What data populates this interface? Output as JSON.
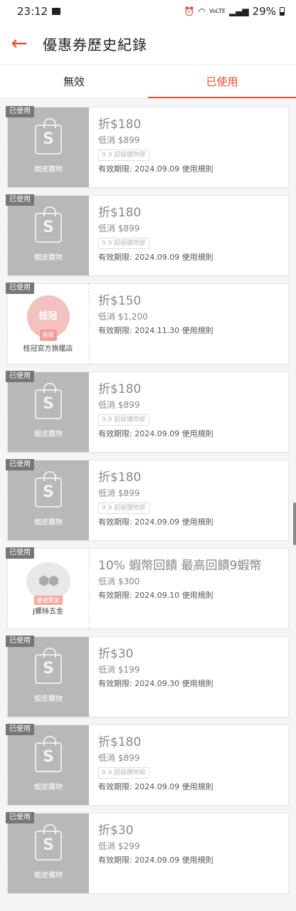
{
  "status": {
    "time": "23:12",
    "battery": "29%"
  },
  "header": {
    "title": "優惠券歷史紀錄"
  },
  "tabs": [
    {
      "label": "無效",
      "active": false
    },
    {
      "label": "已使用",
      "active": true
    }
  ],
  "coupons": [
    {
      "tag": "已使用",
      "shop": "蝦皮購物",
      "logo": "shopee-bag-icon",
      "amount": "折$180",
      "min": "低消 $899",
      "badge": "9.9 超級購物節",
      "expiry": "有效期限: 2024.09.09",
      "rules": "使用規則"
    },
    {
      "tag": "已使用",
      "shop": "蝦皮購物",
      "logo": "shopee-bag-icon",
      "amount": "折$180",
      "min": "低消 $899",
      "badge": "9.9 超級購物節",
      "expiry": "有效期限: 2024.09.09",
      "rules": "使用規則"
    },
    {
      "tag": "已使用",
      "shop": "桂冠官方旗艦店",
      "logo": "guiguan-logo",
      "logo_text": "桂冠",
      "logo_ribbon": "商城",
      "amount": "折$150",
      "min": "低消 $1,200",
      "badge": "",
      "expiry": "有效期限: 2024.11.30",
      "rules": "使用規則"
    },
    {
      "tag": "已使用",
      "shop": "蝦皮購物",
      "logo": "shopee-bag-icon",
      "amount": "折$180",
      "min": "低消 $899",
      "badge": "9.9 超級購物節",
      "expiry": "有效期限: 2024.09.09",
      "rules": "使用規則"
    },
    {
      "tag": "已使用",
      "shop": "蝦皮購物",
      "logo": "shopee-bag-icon",
      "amount": "折$180",
      "min": "低消 $899",
      "badge": "9.9 超級購物節",
      "expiry": "有效期限: 2024.09.09",
      "rules": "使用規則"
    },
    {
      "tag": "已使用",
      "shop": "J螺絲五金",
      "logo": "jscrew-logo",
      "logo_ribbon": "優選賣家",
      "amount": "10% 蝦幣回饋 最高回饋9蝦幣",
      "min": "低消 $300",
      "badge": "",
      "expiry": "有效期限: 2024.09.10",
      "rules": "使用規則"
    },
    {
      "tag": "已使用",
      "shop": "蝦皮購物",
      "logo": "shopee-bag-icon",
      "amount": "折$30",
      "min": "低消 $199",
      "badge": "",
      "expiry": "有效期限: 2024.09.30",
      "rules": "使用規則"
    },
    {
      "tag": "已使用",
      "shop": "蝦皮購物",
      "logo": "shopee-bag-icon",
      "amount": "折$180",
      "min": "低消 $899",
      "badge": "9.9 超級購物節",
      "expiry": "有效期限: 2024.09.09",
      "rules": "使用規則"
    },
    {
      "tag": "已使用",
      "shop": "蝦皮購物",
      "logo": "shopee-bag-icon",
      "amount": "折$30",
      "min": "低消 $299",
      "badge": "",
      "expiry": "有效期限: 2024.09.09",
      "rules": "使用規則"
    }
  ],
  "colors": {
    "accent": "#ee4d2d",
    "used_gray": "#b8b8b8"
  }
}
